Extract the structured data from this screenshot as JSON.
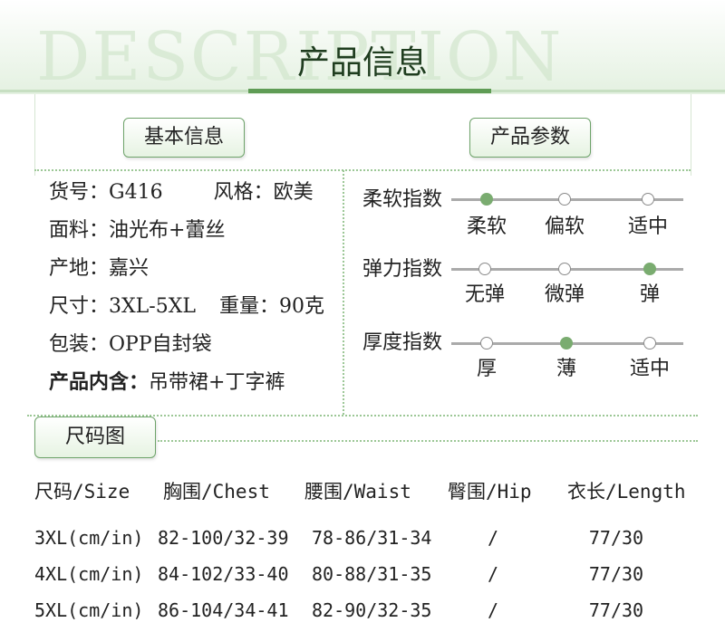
{
  "header": {
    "watermark": "DESCRIPTION",
    "title": "产品信息"
  },
  "sections": {
    "basic": "基本信息",
    "params": "产品参数",
    "size": "尺码图"
  },
  "basic_info": {
    "item_no_label": "货号：",
    "item_no": "G416",
    "style_label": "风格：",
    "style": "欧美",
    "fabric_label": "面料：",
    "fabric": "油光布+蕾丝",
    "origin_label": "产地：",
    "origin": "嘉兴",
    "size_label": "尺寸：",
    "size": "3XL-5XL",
    "weight_label": "重量：",
    "weight": "90克",
    "package_label": "包装：",
    "package": "OPP自封袋",
    "contents_label": "产品内含：",
    "contents": "吊带裙+丁字裤"
  },
  "params": [
    {
      "label": "柔软指数",
      "options": [
        "柔软",
        "偏软",
        "适中"
      ],
      "selected": 0
    },
    {
      "label": "弹力指数",
      "options": [
        "无弹",
        "微弹",
        "弹"
      ],
      "selected": 2
    },
    {
      "label": "厚度指数",
      "options": [
        "厚",
        "薄",
        "适中"
      ],
      "selected": 1
    }
  ],
  "size_table": {
    "headers": [
      "尺码/Size",
      "胸围/Chest",
      "腰围/Waist",
      "臀围/Hip",
      "衣长/Length"
    ],
    "rows": [
      [
        "3XL(cm/in)",
        "82-100/32-39",
        "78-86/31-34",
        "/",
        "77/30"
      ],
      [
        "4XL(cm/in)",
        "84-102/33-40",
        "80-88/31-35",
        "/",
        "77/30"
      ],
      [
        "5XL(cm/in)",
        "86-104/34-41",
        "82-90/32-35",
        "/",
        "77/30"
      ]
    ]
  },
  "colors": {
    "accent": "#5f9c55",
    "active_dot": "#7aac70",
    "dotted_line": "#9cc796"
  }
}
